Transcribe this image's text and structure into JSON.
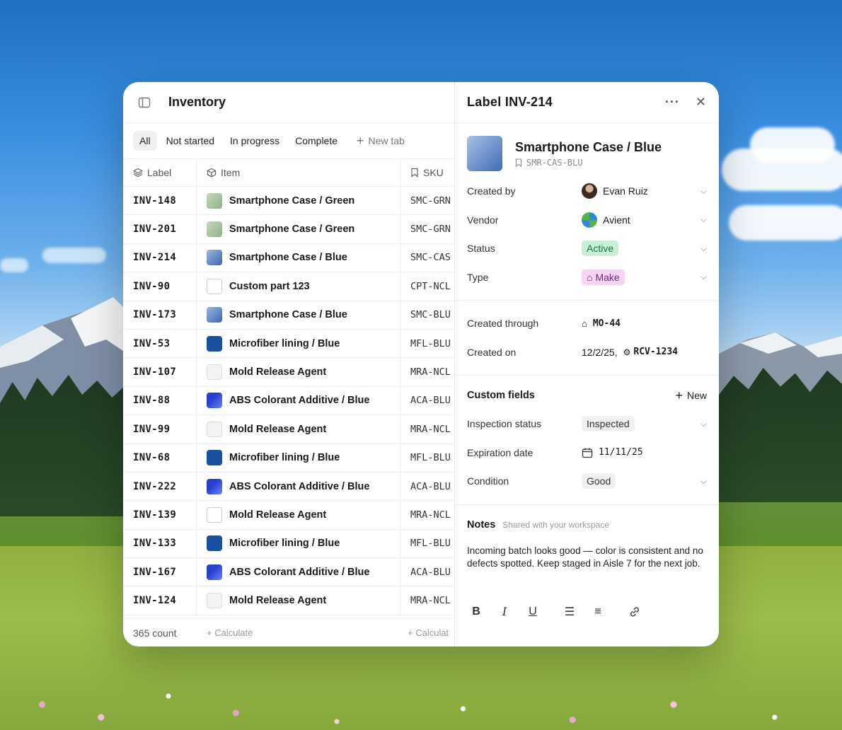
{
  "inventory": {
    "title": "Inventory",
    "tabs": [
      "All",
      "Not started",
      "In progress",
      "Complete"
    ],
    "new_tab_label": "New tab",
    "columns": {
      "label": "Label",
      "item": "Item",
      "sku": "SKU"
    },
    "rows": [
      {
        "label": "INV-148",
        "item": "Smartphone Case / Green",
        "sku": "SMC-GRN",
        "thumb": "green"
      },
      {
        "label": "INV-201",
        "item": "Smartphone Case / Green",
        "sku": "SMC-GRN",
        "thumb": "green"
      },
      {
        "label": "INV-214",
        "item": "Smartphone Case / Blue",
        "sku": "SMC-CAS",
        "thumb": "blue"
      },
      {
        "label": "INV-90",
        "item": "Custom part 123",
        "sku": "CPT-NCL",
        "thumb": "box"
      },
      {
        "label": "INV-173",
        "item": "Smartphone Case / Blue",
        "sku": "SMC-BLU",
        "thumb": "blue"
      },
      {
        "label": "INV-53",
        "item": "Microfiber lining / Blue",
        "sku": "MFL-BLU",
        "thumb": "navy"
      },
      {
        "label": "INV-107",
        "item": "Mold Release Agent",
        "sku": "MRA-NCL",
        "thumb": "pale"
      },
      {
        "label": "INV-88",
        "item": "ABS Colorant Additive / Blue",
        "sku": "ACA-BLU",
        "thumb": "colorant"
      },
      {
        "label": "INV-99",
        "item": "Mold Release Agent",
        "sku": "MRA-NCL",
        "thumb": "pale"
      },
      {
        "label": "INV-68",
        "item": "Microfiber lining / Blue",
        "sku": "MFL-BLU",
        "thumb": "navy"
      },
      {
        "label": "INV-222",
        "item": "ABS Colorant Additive / Blue",
        "sku": "ACA-BLU",
        "thumb": "colorant"
      },
      {
        "label": "INV-139",
        "item": "Mold Release Agent",
        "sku": "MRA-NCL",
        "thumb": "box"
      },
      {
        "label": "INV-133",
        "item": "Microfiber lining / Blue",
        "sku": "MFL-BLU",
        "thumb": "navy"
      },
      {
        "label": "INV-167",
        "item": "ABS Colorant Additive / Blue",
        "sku": "ACA-BLU",
        "thumb": "colorant"
      },
      {
        "label": "INV-124",
        "item": "Mold Release Agent",
        "sku": "MRA-NCL",
        "thumb": "pale"
      }
    ],
    "footer": {
      "count": "365 count",
      "calculate": "+ Calculate",
      "calculate_sku": "+ Calculat"
    }
  },
  "detail": {
    "title": "Label INV-214",
    "product_name": "Smartphone Case / Blue",
    "product_sku": "SMR-CAS-BLU",
    "created_by_label": "Created by",
    "created_by_value": "Evan Ruiz",
    "vendor_label": "Vendor",
    "vendor_value": "Avient",
    "status_label": "Status",
    "status_value": "Active",
    "type_label": "Type",
    "type_value": "Make",
    "created_through_label": "Created through",
    "created_through_value": "MO-44",
    "created_on_label": "Created on",
    "created_on_date": "12/2/25,",
    "created_on_ref": "RCV-1234",
    "custom_fields_title": "Custom fields",
    "new_label": "New",
    "inspection_label": "Inspection status",
    "inspection_value": "Inspected",
    "expiration_label": "Expiration date",
    "expiration_value": "11/11/25",
    "condition_label": "Condition",
    "condition_value": "Good",
    "notes_title": "Notes",
    "notes_sub": "Shared with your workspace",
    "notes_body": "Incoming batch looks good — color is consistent and no defects spotted. Keep staged in Aisle 7 for the next job."
  },
  "colors": {
    "accent_active": "#c7efd6",
    "accent_make": "#f7d4f4"
  }
}
